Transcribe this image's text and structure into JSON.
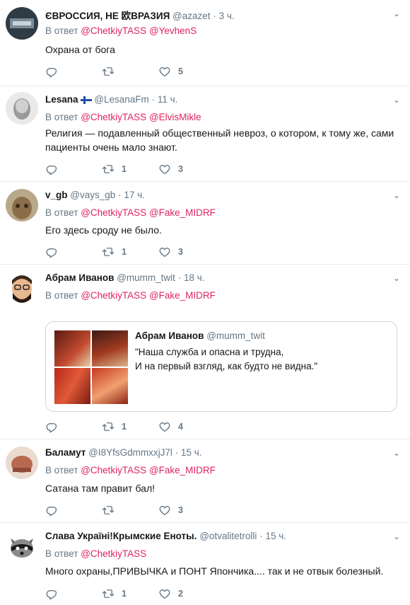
{
  "icons": {
    "reply": "reply-icon",
    "retweet": "retweet-icon",
    "like": "heart-icon",
    "more": "chevron-down-icon"
  },
  "colors": {
    "mention": "#e0245e",
    "secondary": "#657786",
    "border": "#e6ecf0"
  },
  "tweets": [
    {
      "name": "ЄВРОССИЯ, НЕ 欧ВРАЗИЯ",
      "handle": "@azazet",
      "dot": "·",
      "time": "3 ч.",
      "reply_prefix": "В ответ",
      "mentions": [
        "@ChetkiyTASS",
        "@YevhenS"
      ],
      "text": "Охрана от бога",
      "counts": {
        "reply": "",
        "retweet": "",
        "like": "5"
      }
    },
    {
      "name": "Lesana",
      "handle": "@LesanaFm",
      "dot": "·",
      "time": "11 ч.",
      "reply_prefix": "В ответ",
      "mentions": [
        "@ChetkiyTASS",
        "@ElvisMikle"
      ],
      "text": "Религия — подавленный общественный невроз, о котором, к тому же, сами пациенты очень мало знают.",
      "counts": {
        "reply": "",
        "retweet": "1",
        "like": "3"
      }
    },
    {
      "name": "v_gb",
      "handle": "@vays_gb",
      "dot": "·",
      "time": "17 ч.",
      "reply_prefix": "В ответ",
      "mentions": [
        "@ChetkiyTASS",
        "@Fake_MIDRF"
      ],
      "text": "Его здесь сроду не было.",
      "counts": {
        "reply": "",
        "retweet": "1",
        "like": "3"
      }
    },
    {
      "name": "Абрам Иванов",
      "handle": "@mumm_twit",
      "dot": "·",
      "time": "18 ч.",
      "reply_prefix": "В ответ",
      "mentions": [
        "@ChetkiyTASS",
        "@Fake_MIDRF"
      ],
      "quote": {
        "name": "Абрам Иванов",
        "handle": "@mumm_twit",
        "line1": "\"Наша служба и опасна и трудна,",
        "line2": "И на первый взгляд, как будто не видна.\""
      },
      "counts": {
        "reply": "",
        "retweet": "1",
        "like": "4"
      }
    },
    {
      "name": "Баламут",
      "handle": "@I8YfsGdmmxxjJ7l",
      "dot": "·",
      "time": "15 ч.",
      "reply_prefix": "В ответ",
      "mentions": [
        "@ChetkiyTASS",
        "@Fake_MIDRF"
      ],
      "text": "Сатана там правит бал!",
      "counts": {
        "reply": "",
        "retweet": "",
        "like": "3"
      }
    },
    {
      "name": "Слава Україні!Крымские Еноты.",
      "handle": "@otvalitetrolli",
      "dot": "·",
      "time": "15 ч.",
      "reply_prefix": "В ответ",
      "mentions": [
        "@ChetkiyTASS"
      ],
      "text": "Много охраны,ПРИВЫЧКА и ПОНТ Япончика.... так и не отвык болезный.",
      "counts": {
        "reply": "",
        "retweet": "1",
        "like": "2"
      }
    }
  ]
}
